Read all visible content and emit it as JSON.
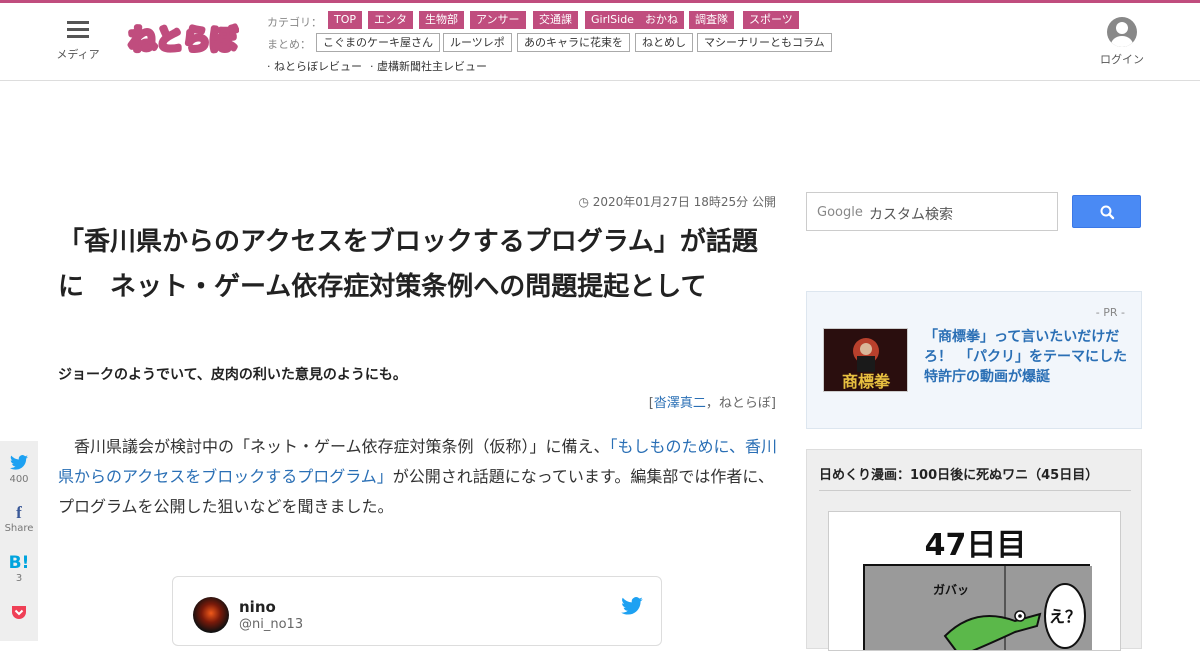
{
  "header": {
    "media_label": "メディア",
    "logo_text": "ねとらぼ",
    "category_label": "カテゴリ：",
    "categories": [
      "TOP",
      "エンタ",
      "生物部",
      "アンサー",
      "交通課",
      "GirlSide",
      "おかね",
      "調査隊",
      "スポーツ"
    ],
    "matome_label": "まとめ：",
    "matome": [
      "こぐまのケーキ屋さん",
      "ルーツレポ",
      "あのキャラに花束を",
      "ねとめし",
      "マシーナリーともコラム"
    ],
    "reviews": [
      "· ねとらぼレビュー",
      "· 虚構新聞社主レビュー"
    ],
    "login_label": "ログイン"
  },
  "article": {
    "date": "2020年01月27日 18時25分 公開",
    "title": "「香川県からのアクセスをブロックするプログラム」が話題に　ネット・ゲーム依存症対策条例への問題提起として",
    "lead": "ジョークのようでいて、皮肉の利いた意見のようにも。",
    "author_open": "[",
    "author_name": "沓澤真二",
    "author_sep": "，",
    "author_site": "ねとらぼ",
    "author_close": "]",
    "body_pre": "　香川県議会が検討中の「ネット・ゲーム依存症対策条例（仮称）」に備え、",
    "body_link": "「もしものために、香川県からのアクセスをブロックするプログラム」",
    "body_post": "が公開され話題になっています。編集部では作者に、プログラムを公開した狙いなどを聞きました。"
  },
  "share": {
    "twitter_count": "400",
    "facebook_label": "Share",
    "hatena_label": "B!",
    "hatena_count": "3"
  },
  "tweet": {
    "name": "nino",
    "handle": "@ni_no13"
  },
  "sidebar": {
    "search_brand": "Google",
    "search_placeholder": "カスタム検索",
    "pr_tag": "- PR -",
    "pr_text": "「商標拳」って言いたいだけだろ！　「パクリ」をテーマにした特許庁の動画が爆誕",
    "pr_thumb_text": "商標拳",
    "manga_title": "日めくり漫画：100日後に死ぬワニ（45日目）",
    "manga_day": "47日目",
    "manga_sfx": "ガバッ",
    "manga_bubble": "え？"
  },
  "colors": {
    "brand": "#c04d7e",
    "link": "#2a6fb5",
    "search_button": "#4a8af4",
    "twitter": "#1da1f2",
    "facebook": "#3b5998",
    "hatena": "#00a4de",
    "pocket": "#ef4056"
  }
}
